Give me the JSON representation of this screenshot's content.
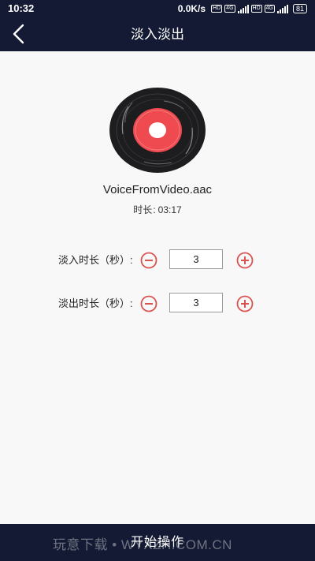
{
  "status_bar": {
    "time": "10:32",
    "network_speed": "0.0K/s",
    "hd_tag": "HD",
    "network_type": "4G",
    "battery": "81"
  },
  "header": {
    "title": "淡入淡出",
    "back_icon": "chevron-left-icon"
  },
  "file": {
    "name": "VoiceFromVideo.aac",
    "duration_label": "时长",
    "duration_sep": ":",
    "duration_value": "03:17",
    "disc_icon": "vinyl-record-icon"
  },
  "fade_in": {
    "label": "淡入时长（秒）:",
    "value": "3",
    "minus_icon": "minus-circle-icon",
    "plus_icon": "plus-circle-icon"
  },
  "fade_out": {
    "label": "淡出时长（秒）:",
    "value": "3",
    "minus_icon": "minus-circle-icon",
    "plus_icon": "plus-circle-icon"
  },
  "action": {
    "start_label": "开始操作"
  },
  "watermark": "玩意下载 • WYXZH.COM.CN",
  "colors": {
    "bar_background": "#141a33",
    "page_background": "#f8f8f8",
    "accent_red": "#d9534f",
    "disc_red": "#ee4a4f"
  }
}
